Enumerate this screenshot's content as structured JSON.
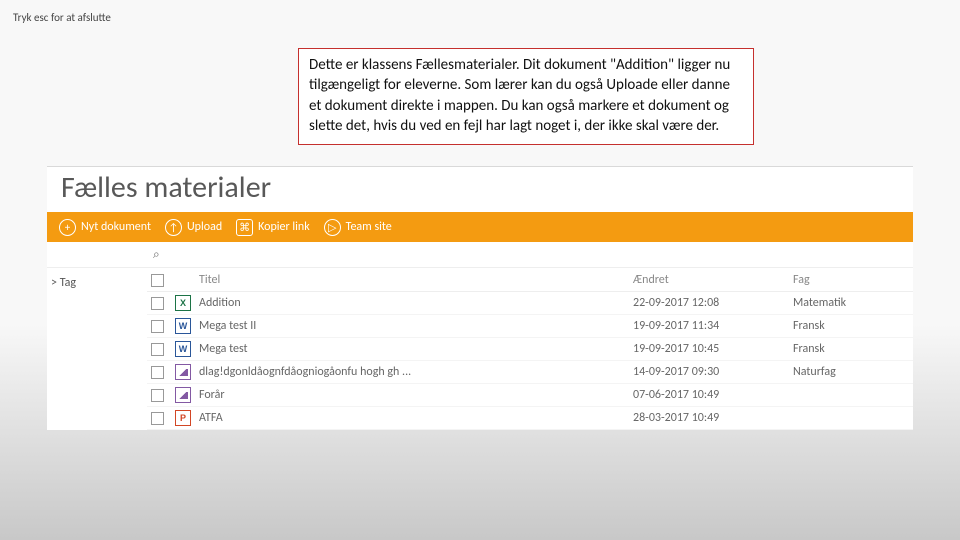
{
  "esc_hint": "Tryk esc for at afslutte",
  "callout_text": "Dette er klassens Fællesmaterialer. Dit dokument \"Addition\" ligger nu tilgængeligt for eleverne. Som lærer kan du også Uploade eller danne et dokument direkte i mappen. Du kan også markere et dokument og slette det, hvis du ved en fejl har lagt noget i, der ikke skal være der.",
  "panel_title": "Fælles materialer",
  "toolbar": {
    "new_doc": "Nyt dokument",
    "upload": "Upload",
    "copy_link": "Kopier link",
    "team_site": "Team site"
  },
  "sidebar": {
    "tag_label": "Tag"
  },
  "table": {
    "headers": {
      "title": "Titel",
      "modified": "Ændret",
      "subject": "Fag"
    },
    "rows": [
      {
        "icon": "excel",
        "icon_letter": "X",
        "title": "Addition",
        "modified": "22-09-2017 12:08",
        "subject": "Matematik"
      },
      {
        "icon": "word",
        "icon_letter": "W",
        "title": "Mega test II",
        "modified": "19-09-2017 11:34",
        "subject": "Fransk"
      },
      {
        "icon": "word",
        "icon_letter": "W",
        "title": "Mega test",
        "modified": "19-09-2017 10:45",
        "subject": "Fransk"
      },
      {
        "icon": "image",
        "icon_letter": "",
        "title": "dlag!dgonldåognfdåogniogåonfu hogh gh ...",
        "modified": "14-09-2017 09:30",
        "subject": "Naturfag"
      },
      {
        "icon": "image",
        "icon_letter": "",
        "title": "Forår",
        "modified": "07-06-2017 10:49",
        "subject": ""
      },
      {
        "icon": "ppt",
        "icon_letter": "P",
        "title": "ATFA",
        "modified": "28-03-2017 10:49",
        "subject": ""
      }
    ]
  }
}
